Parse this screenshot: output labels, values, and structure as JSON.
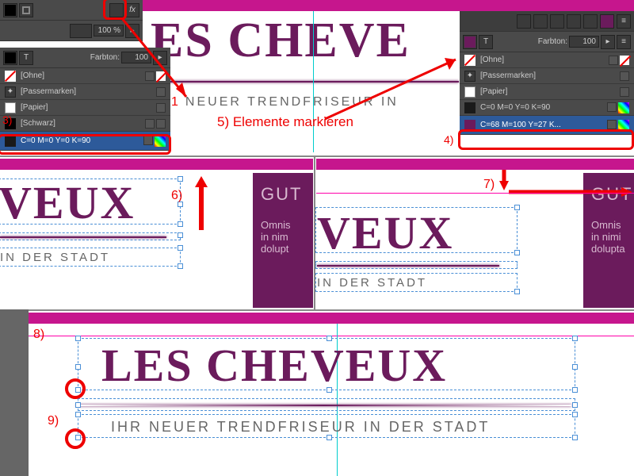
{
  "top_panel_left": {
    "opacity_value": "100 %",
    "fx_label": "fx"
  },
  "swatch_panel_left": {
    "farbton_label": "Farbton:",
    "farbton_value": "100",
    "rows": [
      {
        "name": "[Ohne]"
      },
      {
        "name": "[Passermarken]"
      },
      {
        "name": "[Papier]"
      },
      {
        "name": "[Schwarz]"
      }
    ],
    "selected": "C=0 M=0 Y=0 K=90"
  },
  "swatch_panel_right": {
    "farbton_label": "Farbton:",
    "farbton_value": "100",
    "rows": [
      {
        "name": "[Ohne]"
      },
      {
        "name": "[Passermarken]"
      },
      {
        "name": "[Papier]"
      },
      {
        "name": "C=0 M=0 Y=0 K=90"
      }
    ],
    "selected": "C=68 M=100 Y=27 K..."
  },
  "section1": {
    "heading_fragment": "ES CHEVE",
    "sub_fragment1": "1",
    "sub_fragment2": "NEUER TRENDFRISEUR IN"
  },
  "section2_left": {
    "heading_fragment": "VEUX",
    "sub": "IN DER STADT"
  },
  "section2_purple_left": {
    "title": "GUT",
    "body1": "Omnis",
    "body2": "in nim",
    "body3": "dolupt"
  },
  "section2_right": {
    "heading_fragment": "VEUX",
    "sub": "IN DER STADT"
  },
  "section2_purple_right": {
    "title": "GUT",
    "body1": "Omnis",
    "body2": "in nimi",
    "body3": "dolupta"
  },
  "section3": {
    "heading": "LES CHEVEUX",
    "sub": "IHR NEUER TRENDFRISEUR IN DER STADT"
  },
  "annotations": {
    "a3": "3)",
    "a4": "4)",
    "a5": "5) Elemente markieren",
    "a6": "6)",
    "a7": "7)",
    "a8": "8)",
    "a9": "9)"
  }
}
